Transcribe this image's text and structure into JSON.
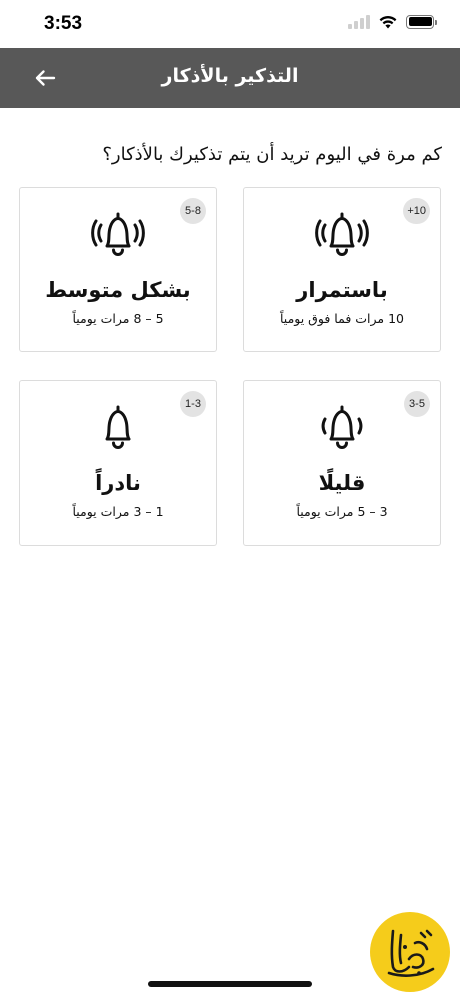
{
  "status_bar": {
    "time": "3:53",
    "battery_level": 1.0
  },
  "header": {
    "title": "التذكير بالأذكار",
    "back_icon": "arrow-left-icon"
  },
  "question": "كم مرة في اليوم تريد أن يتم تذكيرك بالأذكار؟",
  "options": [
    {
      "badge": "+10",
      "title": "باستمرار",
      "subtitle": "10 مرات فما فوق يومياً",
      "icon": "bell-ringing-icon"
    },
    {
      "badge": "5-8",
      "title": "بشكل متوسط",
      "subtitle": "5 – 8 مرات يومياً",
      "icon": "bell-ringing-icon"
    },
    {
      "badge": "3-5",
      "title": "قليلًا",
      "subtitle": "3 – 5 مرات يومياً",
      "icon": "bell-light-icon"
    },
    {
      "badge": "1-3",
      "title": "نادراً",
      "subtitle": "1 – 3 مرات يومياً",
      "icon": "bell-icon"
    }
  ],
  "logo": {
    "icon": "app-logo-icon",
    "color": "#f5cc1b"
  },
  "colors": {
    "app_bar": "#585858",
    "badge": "#e3e3e3",
    "card_border": "#dcdcdc"
  }
}
